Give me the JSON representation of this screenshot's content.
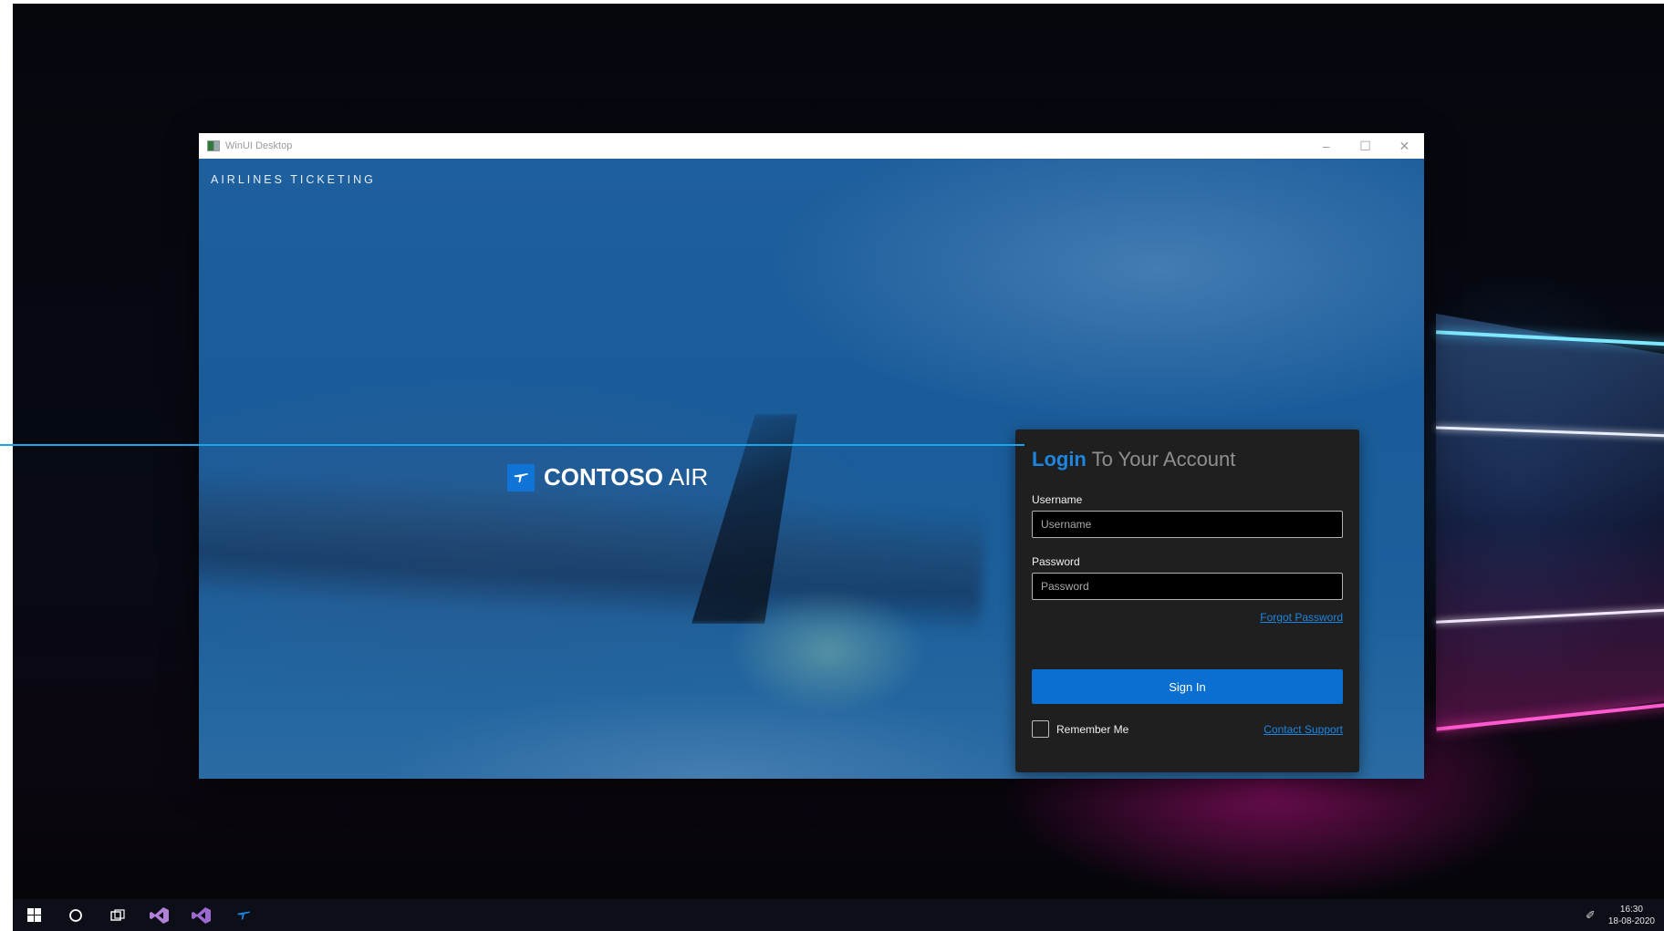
{
  "window": {
    "title": "WinUI Desktop",
    "minimize_glyph": "–",
    "maximize_glyph": "☐",
    "close_glyph": "✕"
  },
  "app": {
    "brand": "AIRLINES TICKETING",
    "logo_bold": "CONTOSO",
    "logo_light": "AIR",
    "logo_icon": "airplane-icon"
  },
  "login": {
    "heading_accent": "Login",
    "heading_rest": "To Your Account",
    "username_label": "Username",
    "username_placeholder": "Username",
    "password_label": "Password",
    "password_placeholder": "Password",
    "forgot_password": "Forgot Password",
    "sign_in": "Sign In",
    "remember_me": "Remember Me",
    "contact_support": "Contact Support"
  },
  "taskbar": {
    "items": [
      "windows-start-icon",
      "search-circle-icon",
      "task-view-icon",
      "visual-studio-icon",
      "visual-studio-icon",
      "contoso-air-app-icon"
    ],
    "clock_time": "16:30",
    "clock_date": "18-08-2020",
    "tray_icon": "pen-icon"
  },
  "colors": {
    "accent": "#1d86e0",
    "button": "#0a6fd1",
    "card": "#1f1f1f",
    "guide_line": "#18a6e8"
  }
}
